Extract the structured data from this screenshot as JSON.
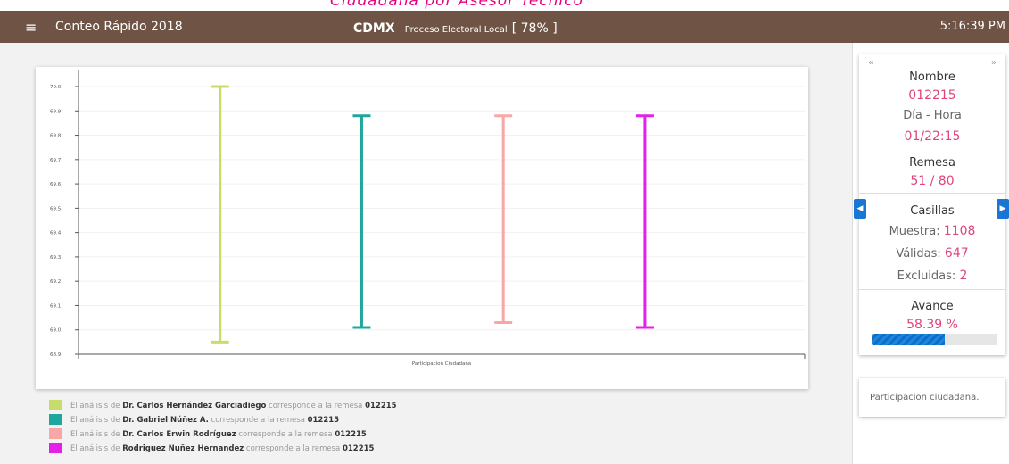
{
  "top_banner": "Ciudadana por Asesor Técnico",
  "navbar": {
    "menu_icon": "hamburger-icon",
    "title": "Conteo Rápido 2018",
    "state": "CDMX",
    "process": "Proceso Electoral Local",
    "progress_text": "[ 78% ]",
    "time": "5:16:39 PM",
    "bg_color": "#6f5445"
  },
  "chart_data": {
    "type": "errorbar",
    "categories": [
      "Participacion Ciudadana"
    ],
    "xlabel": "",
    "ylabel": "",
    "ylim": [
      68.9,
      70.0
    ],
    "yticks": [
      "70.0",
      "69.9",
      "69.8",
      "69.7",
      "69.6",
      "69.5",
      "69.4",
      "69.3",
      "69.2",
      "69.1",
      "69.0",
      "68.9"
    ],
    "grid": true,
    "series": [
      {
        "low": 68.95,
        "high": 70.0,
        "color": "#c8dc6c"
      },
      {
        "low": 69.01,
        "high": 69.88,
        "color": "#1fa79d"
      },
      {
        "low": 69.03,
        "high": 69.88,
        "color": "#f7a8a6"
      },
      {
        "low": 69.01,
        "high": 69.88,
        "color": "#e61ee9"
      }
    ]
  },
  "legend": [
    {
      "prefix": "El análisis de",
      "name": "Dr. Carlos Hernández Garciadiego",
      "middle": "corresponde a la remesa",
      "remesa": "012215",
      "color": "#c8dc6c"
    },
    {
      "prefix": "El análisis de",
      "name": "Dr. Gabriel Núñez A.",
      "middle": "corresponde a la remesa",
      "remesa": "012215",
      "color": "#1fa79d"
    },
    {
      "prefix": "El análisis de",
      "name": "Dr. Carlos Erwin Rodríguez",
      "middle": "corresponde a la remesa",
      "remesa": "012215",
      "color": "#f7a8a6"
    },
    {
      "prefix": "El análisis de",
      "name": "Rodriguez Nuñez Hernandez",
      "middle": "corresponde a la remesa",
      "remesa": "012215",
      "color": "#e61ee9"
    }
  ],
  "side": {
    "prev_chevron": "«",
    "next_chevron": "»",
    "nombre_label": "Nombre",
    "nombre_value": "012215",
    "dia_hora_label": "Día - Hora",
    "dia_hora_value": "01/22:15",
    "remesa_label": "Remesa",
    "remesa_value": "51 / 80",
    "casillas_label": "Casillas",
    "muestra_label": "Muestra:",
    "muestra_value": "1108",
    "validas_label": "Válidas:",
    "validas_value": "647",
    "excluidas_label": "Excluidas:",
    "excluidas_value": "2",
    "avance_label": "Avance",
    "avance_value": "58.39 %",
    "avance_fraction": 0.5839,
    "left_arrow": "◀",
    "right_arrow": "▶",
    "note": "Participacion ciudadana."
  }
}
